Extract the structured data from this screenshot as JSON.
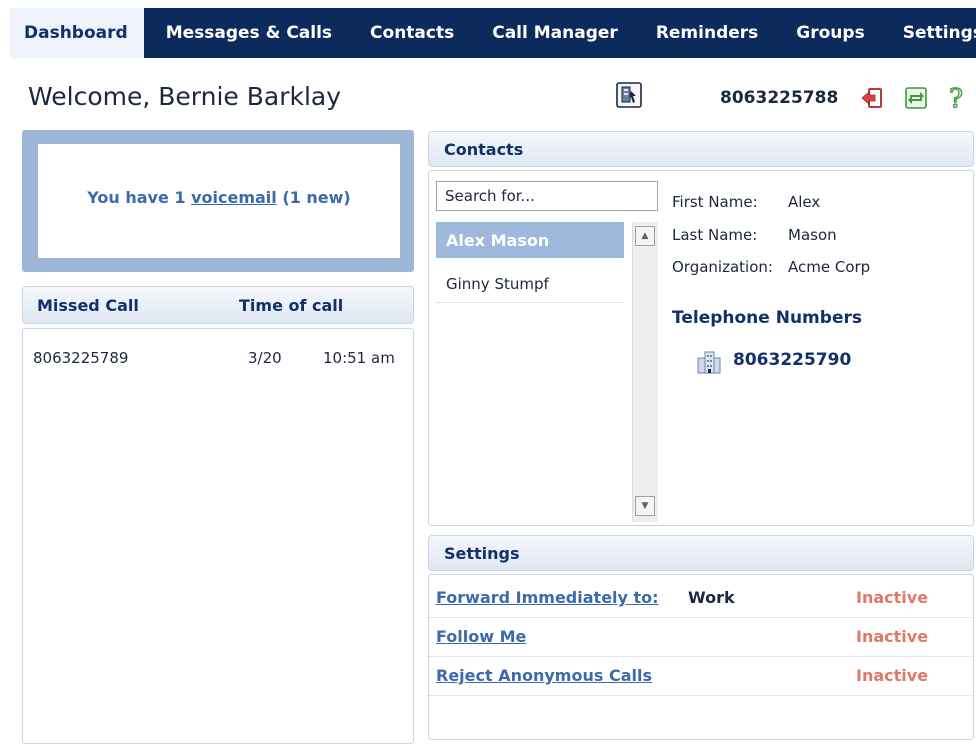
{
  "nav": {
    "tabs": [
      {
        "label": "Dashboard",
        "active": true
      },
      {
        "label": "Messages & Calls",
        "active": false
      },
      {
        "label": "Contacts",
        "active": false
      },
      {
        "label": "Call Manager",
        "active": false
      },
      {
        "label": "Reminders",
        "active": false
      },
      {
        "label": "Groups",
        "active": false
      },
      {
        "label": "Settings",
        "active": false
      }
    ]
  },
  "header": {
    "welcome": "Welcome, Bernie Barklay",
    "phone_number": "8063225788",
    "icons": [
      "phone-directory-icon",
      "logout-icon",
      "refresh-icon",
      "help-icon"
    ]
  },
  "voicemail": {
    "prefix": "You have 1 ",
    "link": "voicemail",
    "suffix": " (1 new)"
  },
  "missed_calls": {
    "columns": [
      "Missed Call",
      "Time of call"
    ],
    "rows": [
      {
        "number": "8063225789",
        "date": "3/20",
        "time": "10:51 am"
      }
    ]
  },
  "contacts": {
    "title": "Contacts",
    "search_value": "Search for...",
    "list": [
      {
        "name": "Alex Mason",
        "selected": true
      },
      {
        "name": "Ginny Stumpf",
        "selected": false
      }
    ],
    "details": {
      "first_name_label": "First Name:",
      "first_name": "Alex",
      "last_name_label": "Last Name:",
      "last_name": "Mason",
      "organization_label": "Organization:",
      "organization": "Acme Corp"
    },
    "telephone_title": "Telephone Numbers",
    "telephone_number": "8063225790"
  },
  "settings": {
    "title": "Settings",
    "rows": [
      {
        "label": "Forward Immediately to:",
        "value": "Work",
        "status": "Inactive"
      },
      {
        "label": "Follow Me",
        "value": "",
        "status": "Inactive"
      },
      {
        "label": "Reject Anonymous Calls",
        "value": "",
        "status": "Inactive"
      }
    ]
  },
  "colors": {
    "nav_bg": "#0c2b5c",
    "accent": "#3d6aaa",
    "inactive": "#e07a66",
    "panel_blue": "#9eb7d9"
  }
}
